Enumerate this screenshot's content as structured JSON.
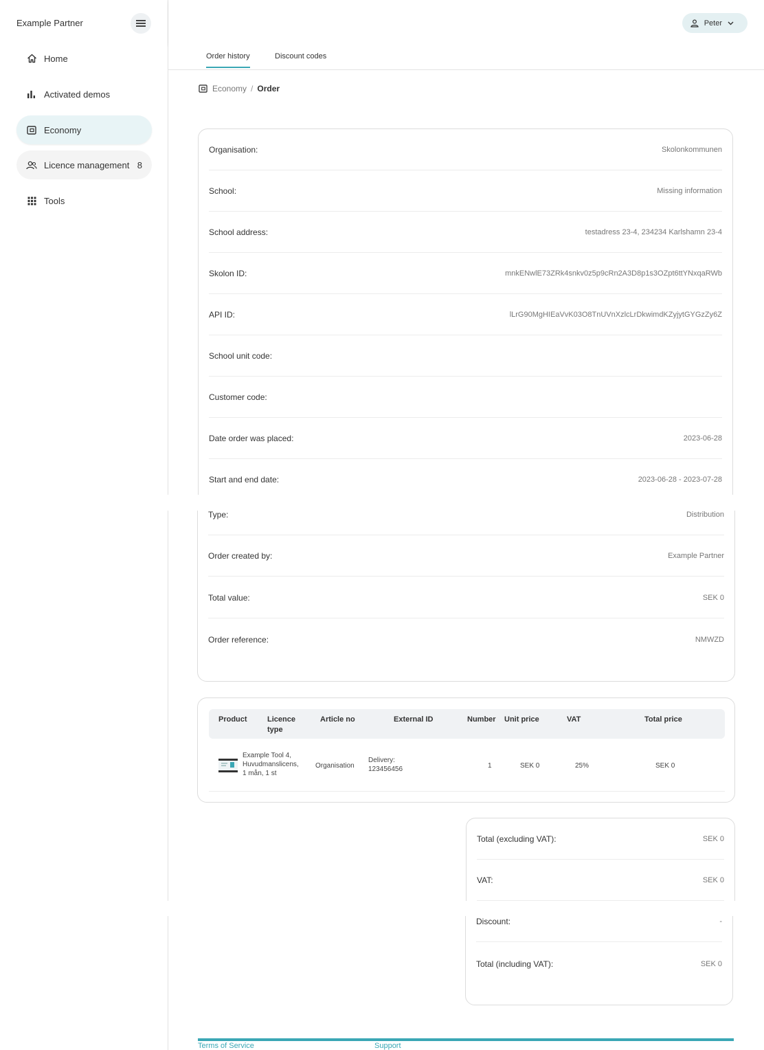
{
  "brand": {
    "name": "Example Partner"
  },
  "sidebar": {
    "items": [
      {
        "label": "Home",
        "icon": "home-icon"
      },
      {
        "label": "Activated demos",
        "icon": "bar-chart-icon"
      },
      {
        "label": "Economy",
        "icon": "wallet-icon",
        "active": true
      },
      {
        "label": "Licence management",
        "icon": "users-icon",
        "count": "8"
      },
      {
        "label": "Tools",
        "icon": "grid-icon"
      }
    ]
  },
  "header": {
    "user": "Peter"
  },
  "tabs": [
    {
      "label": "Order history",
      "active": true
    },
    {
      "label": "Discount codes"
    }
  ],
  "breadcrumb": {
    "parent": "Economy",
    "separator": "/",
    "current": "Order"
  },
  "order_details": {
    "rows": [
      {
        "label": "Organisation:",
        "value": "Skolonkommunen"
      },
      {
        "label": "School:",
        "value": "Missing information"
      },
      {
        "label": "School address:",
        "value": "testadress 23-4, 234234 Karlshamn 23-4"
      },
      {
        "label": "Skolon ID:",
        "value": "mnkENwlE73ZRk4snkv0z5p9cRn2A3D8p1s3OZpt6ttYNxqaRWb"
      },
      {
        "label": "API ID:",
        "value": "lLrG90MgHIEaVvK03O8TnUVnXzlcLrDkwimdKZyjytGYGzZy6Z"
      },
      {
        "label": "School unit code:",
        "value": ""
      },
      {
        "label": "Customer code:",
        "value": ""
      },
      {
        "label": "Date order was placed:",
        "value": "2023-06-28"
      },
      {
        "label": "Start and end date:",
        "value": "2023-06-28 - 2023-07-28"
      }
    ],
    "rows_continued": [
      {
        "label": "Type:",
        "value": "Distribution"
      },
      {
        "label": "Order created by:",
        "value": "Example Partner"
      },
      {
        "label": "Total value:",
        "value": "SEK 0"
      },
      {
        "label": "Order reference:",
        "value": "NMWZD"
      }
    ]
  },
  "products_table": {
    "headers": {
      "product": "Product",
      "licence_type_1": "Licence",
      "licence_type_2": "type",
      "article_no": "Article no",
      "external_id": "External ID",
      "number": "Number",
      "unit_price": "Unit price",
      "vat": "VAT",
      "total_price": "Total price"
    },
    "row": {
      "product_line1": "Example Tool 4,",
      "product_line2": "Huvudmanslicens,",
      "product_line3": "1 mån, 1 st",
      "licence_type": "Organisation",
      "article_line1": "Delivery:",
      "article_line2": "123456456",
      "external_id": "",
      "number": "1",
      "unit_price": "SEK 0",
      "vat": "25%",
      "total_price": "SEK 0"
    }
  },
  "totals": {
    "rows": [
      {
        "label": "Total (excluding VAT):",
        "value": "SEK 0"
      },
      {
        "label": "VAT:",
        "value": "SEK 0"
      }
    ],
    "rows_continued": [
      {
        "label": "Discount:",
        "value": "-"
      },
      {
        "label": "Total (including VAT):",
        "value": "SEK 0"
      }
    ]
  },
  "footer": {
    "terms": "Terms of Service",
    "support": "Support"
  },
  "colors": {
    "accent": "#3aa7b5",
    "active_nav": "#e8f4f6",
    "chip": "#e4f0f2"
  }
}
